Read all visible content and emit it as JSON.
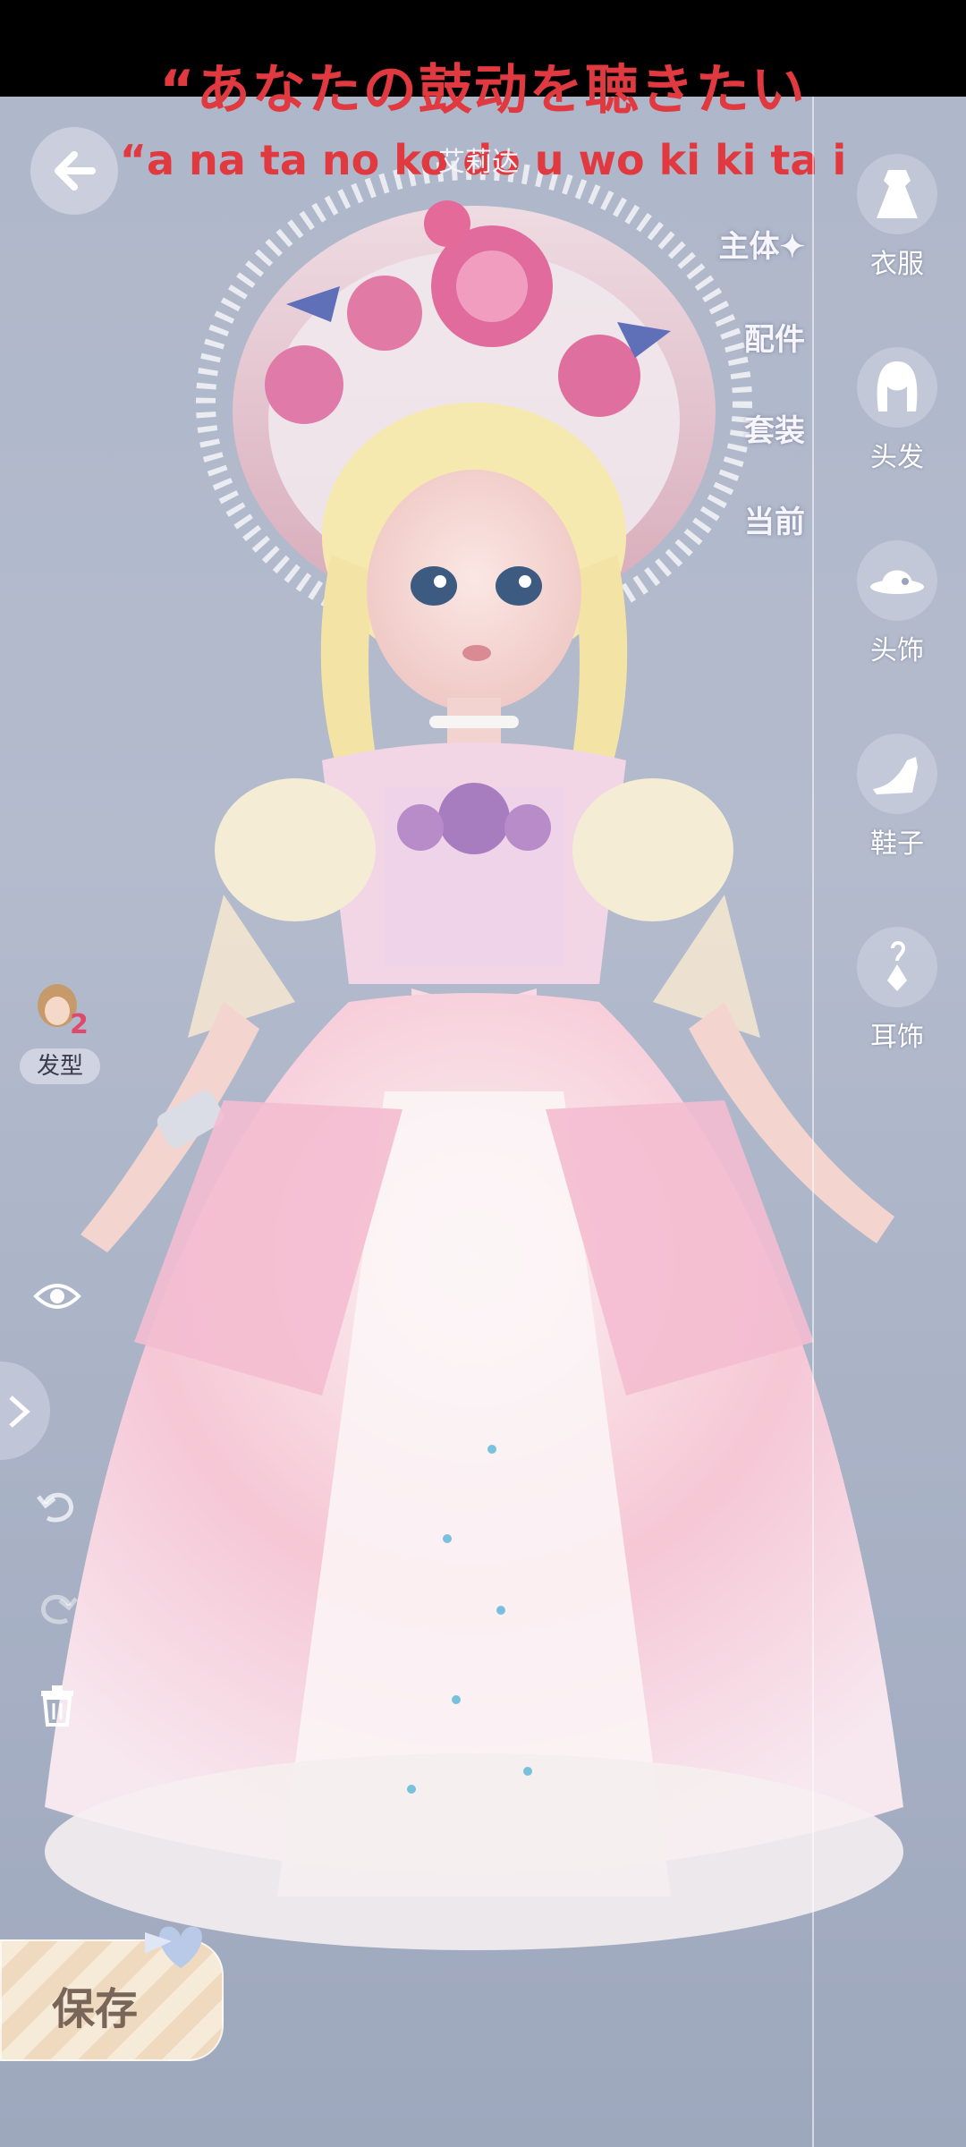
{
  "lyrics": {
    "japanese": "“あなたの鼓动を聴きたい",
    "romaji": "“a na ta no ko do u wo ki ki ta i"
  },
  "header": {
    "back_icon": "back-arrow-icon",
    "subtitle": "艾莉达"
  },
  "submenu": {
    "items": [
      {
        "label": "主体✦",
        "active": true
      },
      {
        "label": "配件",
        "active": false
      },
      {
        "label": "套装",
        "active": false
      },
      {
        "label": "当前",
        "active": false
      }
    ]
  },
  "categories": [
    {
      "label": "衣服",
      "icon": "dress-icon"
    },
    {
      "label": "头发",
      "icon": "hair-icon"
    },
    {
      "label": "头饰",
      "icon": "hat-icon"
    },
    {
      "label": "鞋子",
      "icon": "shoe-icon"
    },
    {
      "label": "耳饰",
      "icon": "earring-icon"
    }
  ],
  "left_tools": {
    "hairstyle": {
      "label": "发型",
      "count": "2"
    },
    "eye_icon": "eye-icon",
    "undo_icon": "undo-icon",
    "redo_icon": "redo-icon",
    "delete_icon": "trash-icon"
  },
  "save_button": {
    "label": "保存"
  },
  "colors": {
    "lyric_red": "#e0393f",
    "background": "#aeb6c9",
    "dress_pink": "#f4bcd0"
  }
}
